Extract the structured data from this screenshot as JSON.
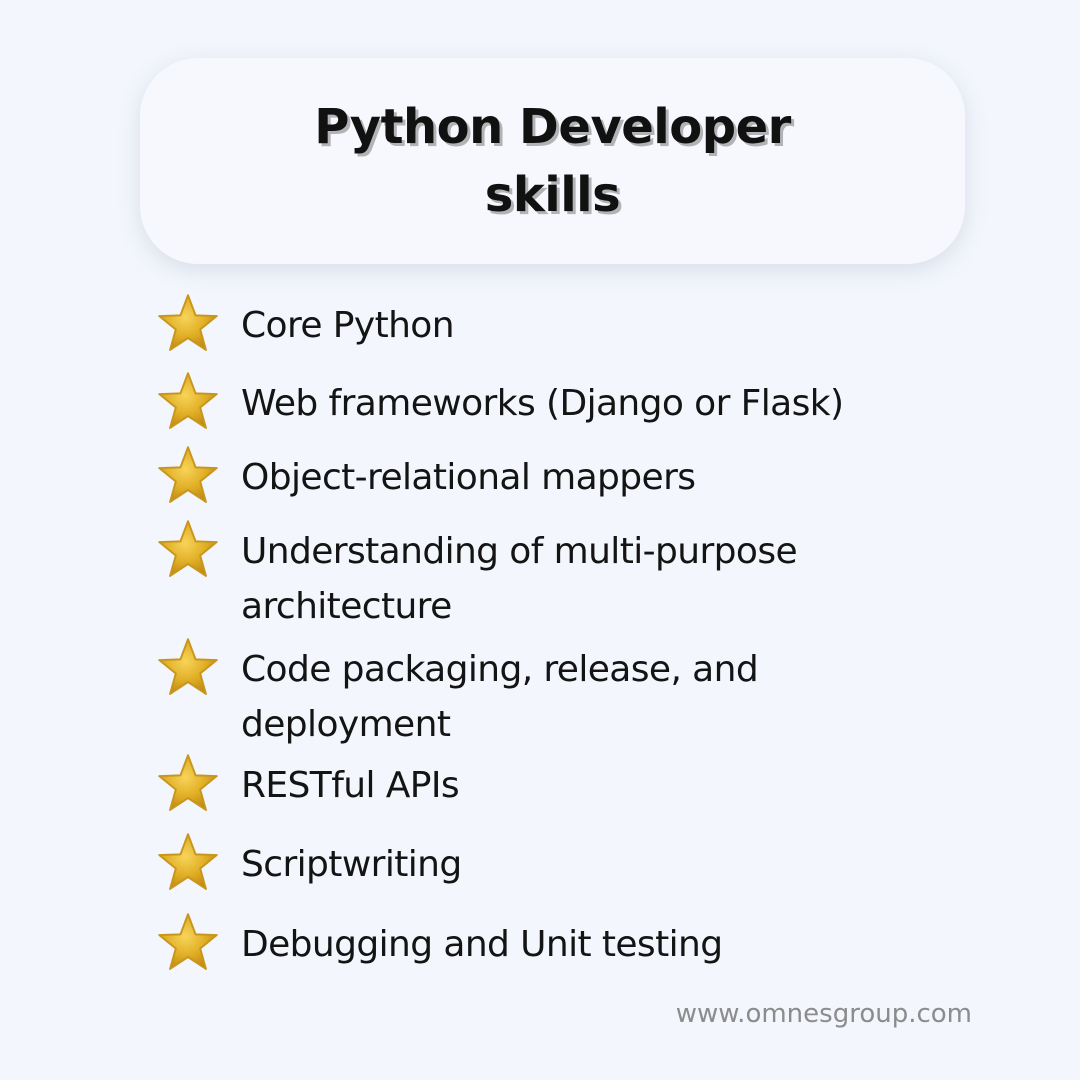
{
  "title": {
    "line1": "Python Developer",
    "line2": "skills"
  },
  "skills": [
    {
      "line1": "Core Python",
      "line2": ""
    },
    {
      "line1": "Web frameworks (Django or Flask)",
      "line2": ""
    },
    {
      "line1": "Object-relational mappers",
      "line2": ""
    },
    {
      "line1": "Understanding of multi-purpose",
      "line2": "architecture"
    },
    {
      "line1": "Code packaging, release, and",
      "line2": "deployment"
    },
    {
      "line1": "RESTful APIs",
      "line2": ""
    },
    {
      "line1": "Scriptwriting",
      "line2": ""
    },
    {
      "line1": "Debugging and Unit testing",
      "line2": ""
    }
  ],
  "bullet_icon": "star-icon",
  "footer": {
    "url": "www.omnesgroup.com"
  },
  "colors": {
    "background": "#f3f6fc",
    "card": "#f6f8fd",
    "star": "#e2b22a",
    "text": "#141414",
    "footer_text": "#8c8c8c"
  }
}
